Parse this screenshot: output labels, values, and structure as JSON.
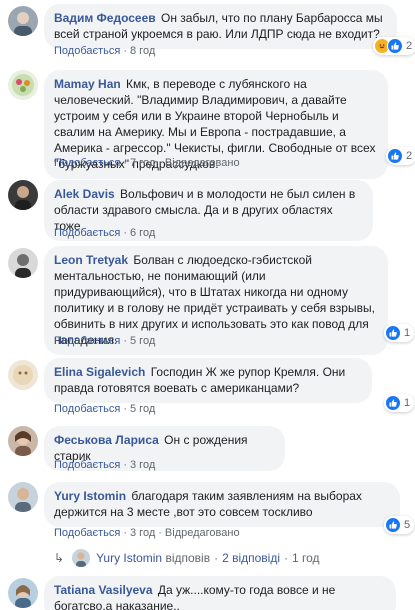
{
  "comments": [
    {
      "author": "Вадим Федосеев",
      "text": "Он забыл, что по плану Барбаросса мы всей страной укроемся в раю. Или ЛДПР сюда не входит?",
      "like_label": "Подобається",
      "reply_label": "Відповісти",
      "time": "8 год",
      "edited": "",
      "reaction_icons": [
        "haha-icon",
        "like-icon"
      ],
      "reaction_count": "2"
    },
    {
      "author": "Mamay Han",
      "text": "Кмк, в переводе с лубянского на человеческий. \"Владимир Владимирович, а давайте устроим у себя или в Украине второй Чернобыль и свалим на Америку. Мы и Европа - пострадавшие, а Америка - агрессор.\" Чекисты, фигли. Свободные от всех \"буржуазных\" предрассудков.",
      "like_label": "Подобається",
      "reply_label": "Відповісти",
      "time": "7 год",
      "edited": "Відредаговано",
      "reaction_icons": [
        "like-icon"
      ],
      "reaction_count": "2"
    },
    {
      "author": "Alek Davis",
      "text": "Вольфович и в молодости не был силен в области здравого смысла. Да и в других областях тоже.",
      "like_label": "Подобається",
      "reply_label": "Відповісти",
      "time": "6 год",
      "edited": "",
      "reaction_icons": [],
      "reaction_count": ""
    },
    {
      "author": "Leon Tretyak",
      "text": "Болван с людоедско-гэбистской ментальностью, не понимающий (или придуривающийся), что в Штатах никогда ни одному политику и в голову не придёт устраивать у себя взрывы, обвинить в них других и использовать это как повод для нападения.",
      "like_label": "Подобається",
      "reply_label": "Відповісти",
      "time": "5 год",
      "edited": "",
      "reaction_icons": [
        "like-icon"
      ],
      "reaction_count": "1"
    },
    {
      "author": "Elina Sigalevich",
      "text": "Господин Ж же рупор Кремля. Они правда готовятся воевать с американцами?",
      "like_label": "Подобається",
      "reply_label": "Відповісти",
      "time": "5 год",
      "edited": "",
      "reaction_icons": [
        "like-icon"
      ],
      "reaction_count": "1"
    },
    {
      "author": "Феськова Лариса",
      "text": "Он с рождения старик",
      "like_label": "Подобається",
      "reply_label": "Відповісти",
      "time": "3 год",
      "edited": "",
      "reaction_icons": [],
      "reaction_count": ""
    },
    {
      "author": "Yury Istomin",
      "text": "благодаря таким заявлениям на выборах держится на 3 месте ,вот это совсем тоскливо",
      "like_label": "Подобається",
      "reply_label": "Відповісти",
      "time": "3 год",
      "edited": "Відредаговано",
      "reaction_icons": [
        "like-icon"
      ],
      "reaction_count": "5"
    },
    {
      "author": "Tatiana Vasilyeva",
      "text": "Да уж....кому-то года вовсе и не богатсво,а наказание..",
      "like_label": "",
      "reply_label": "",
      "time": "",
      "edited": "",
      "reaction_icons": [],
      "reaction_count": ""
    }
  ],
  "replies_link": {
    "author": "Yury Istomin",
    "action": "відповів",
    "count": "2 відповіді",
    "time": "1 год"
  },
  "colors": {
    "link": "#385898",
    "bubble": "#f2f3f5",
    "like_blue": "#1877f2",
    "haha_yellow": "#f7b125"
  }
}
